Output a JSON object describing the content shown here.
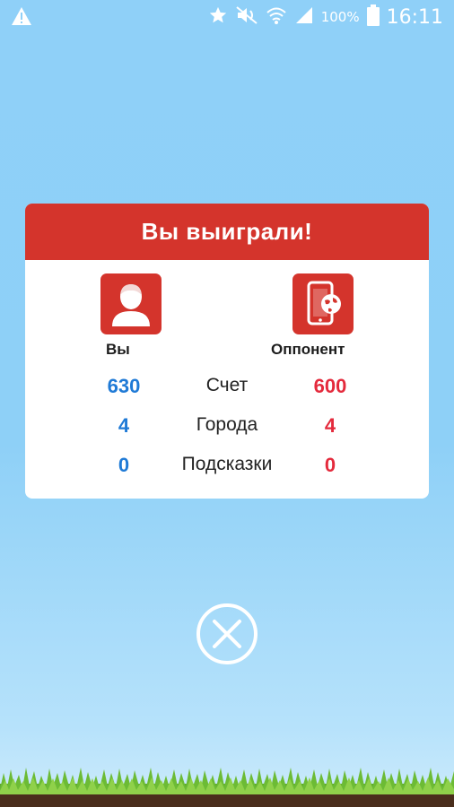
{
  "status_bar": {
    "icons": [
      "warning-icon",
      "star-icon",
      "mute-icon",
      "wifi-icon",
      "signal-icon",
      "battery-icon"
    ],
    "battery_percent": "100%",
    "time": "16:11"
  },
  "dialog": {
    "title": "Вы выиграли!",
    "you": {
      "label": "Вы",
      "icon": "user-icon"
    },
    "opponent": {
      "label": "Оппонент",
      "icon": "phone-globe-icon"
    },
    "rows": [
      {
        "label": "Счет",
        "you": "630",
        "opponent": "600"
      },
      {
        "label": "Города",
        "you": "4",
        "opponent": "4"
      },
      {
        "label": "Подсказки",
        "you": "0",
        "opponent": "0"
      }
    ],
    "colors": {
      "header": "#d4342c",
      "you": "#1f7ad6",
      "opponent": "#e42a3c"
    }
  },
  "close": {
    "icon": "close-icon"
  }
}
